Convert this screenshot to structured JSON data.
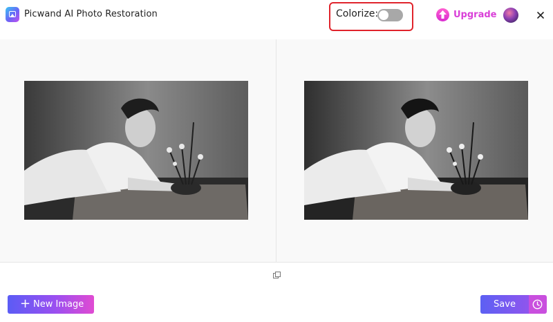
{
  "app": {
    "title": "Picwand AI Photo Restoration"
  },
  "header": {
    "colorize_label": "Colorize:",
    "colorize_enabled": false,
    "upgrade_label": "Upgrade",
    "avatar_icon": "user-avatar",
    "close_icon": "close-icon"
  },
  "workspace": {
    "original_image": "black-and-white portrait photo",
    "restored_image": "black-and-white portrait photo",
    "compare_icon": "compare-icon"
  },
  "footer": {
    "new_image_label": "New Image",
    "save_label": "Save",
    "history_icon": "clock-icon"
  },
  "colors": {
    "accent_purple": "#8f55ee",
    "accent_pink": "#d93fd8",
    "highlight_red": "#e0232b",
    "toggle_off": "#a8a8a8"
  }
}
